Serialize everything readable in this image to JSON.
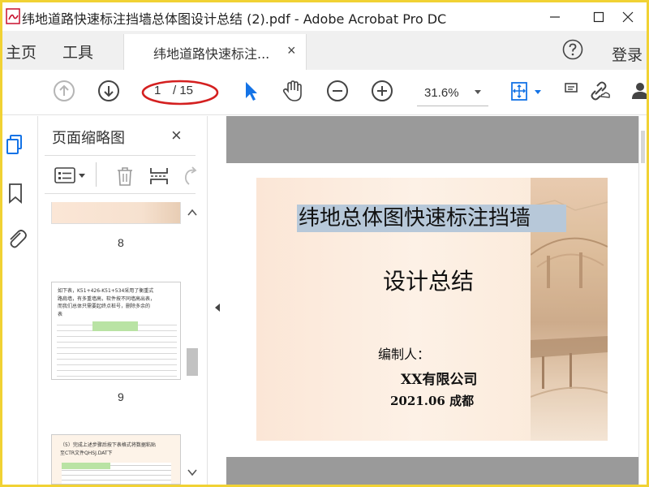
{
  "window": {
    "title": "纬地道路快速标注挡墙总体图设计总结 (2).pdf - Adobe Acrobat Pro DC",
    "frame_color": "#f1d234"
  },
  "menu": {
    "home": "主页",
    "tools": "工具",
    "login": "登录"
  },
  "tab": {
    "label": "纬地道路快速标注...",
    "close": "×"
  },
  "toolbar": {
    "page_current": "1",
    "page_total": "/ 15",
    "zoom": "31.6%"
  },
  "panel": {
    "title": "页面缩略图",
    "close": "×",
    "page_labels": [
      "8",
      "9"
    ],
    "thumb9_lines": [
      "如下表，K51+426-K51+534采用了衡重式",
      "路肩墙，有多重墙高，软件按不同墙高出表，",
      "而我们总体只需要起终点桩号，删除多余的",
      "表"
    ],
    "thumb10_lines": [
      "（5）完成上述步骤后按下表格式将数据粘贴",
      "至CTR文件QHSJ.DAT下"
    ]
  },
  "slide": {
    "title": "纬地总体图快速标注挡墙",
    "subtitle": "设计总结",
    "editor": "编制人：",
    "company": "XX有限公司",
    "date": "2021.06 成都"
  },
  "colors": {
    "accent_blue": "#1473e6",
    "ellipse_red": "#d42020",
    "doc_gray": "#9a9a9a",
    "title_highlight": "#b7c8d9"
  },
  "icons": [
    "app-icon",
    "minimize-icon",
    "maximize-icon",
    "close-icon",
    "help-icon",
    "prev-page-icon",
    "next-page-icon",
    "select-arrow-icon",
    "hand-icon",
    "zoom-out-icon",
    "zoom-in-icon",
    "fit-page-icon",
    "comment-icon",
    "link-icon",
    "user-icon",
    "thumbnails-icon",
    "bookmark-icon",
    "attachment-icon",
    "options-icon",
    "delete-icon",
    "insert-page-icon",
    "rotate-icon"
  ]
}
